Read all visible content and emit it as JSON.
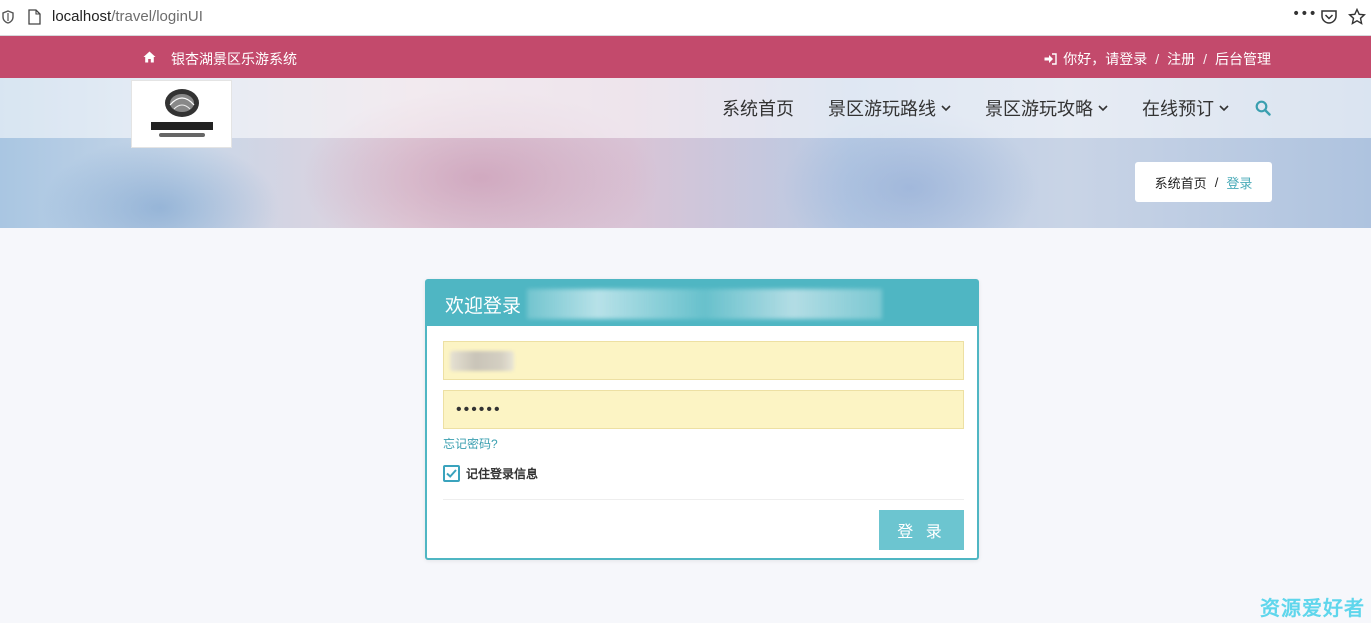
{
  "browser": {
    "url_host": "localhost",
    "url_path": "/travel/loginUI",
    "menu_dots": "•••"
  },
  "topbar": {
    "site_name": "银杏湖景区乐游系统",
    "greeting": "你好，请登录",
    "register": "注册",
    "admin": "后台管理",
    "separator": "/"
  },
  "nav": {
    "items": [
      {
        "label": "系统首页"
      },
      {
        "label": "景区游玩路线"
      },
      {
        "label": "景区游玩攻略"
      },
      {
        "label": "在线预订"
      }
    ]
  },
  "breadcrumb": {
    "home": "系统首页",
    "separator": "/",
    "current": "登录"
  },
  "login": {
    "title": "欢迎登录",
    "username_value": "",
    "password_value": "••••••",
    "forgot": "忘记密码?",
    "remember": "记住登录信息",
    "remember_checked": true,
    "submit": "登 录"
  },
  "watermark": "资源爱好者",
  "colors": {
    "topbar": "#c34a6c",
    "accent": "#4fb6c3",
    "button": "#6cc5d0",
    "field_bg": "#fcf4c4"
  }
}
